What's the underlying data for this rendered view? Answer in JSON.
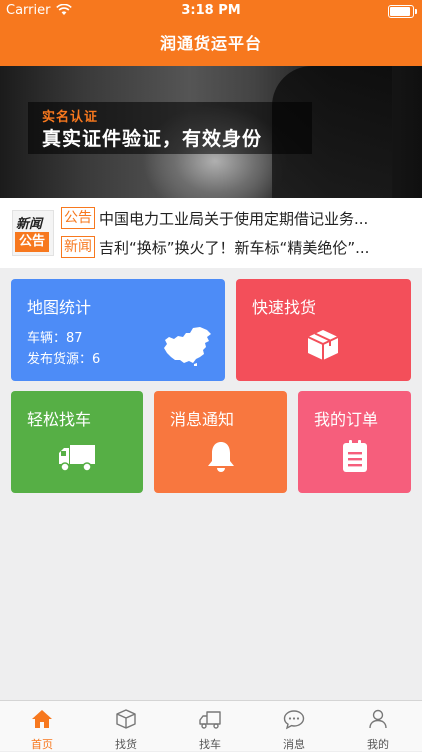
{
  "statusbar": {
    "carrier": "Carrier",
    "time": "3:18 PM"
  },
  "navbar": {
    "title": "润通货运平台"
  },
  "banner": {
    "small_text": "实名认证",
    "big_text": "真实证件验证，有效身份"
  },
  "news": {
    "logo_line1": "新闻",
    "logo_line2": "公告",
    "items": [
      {
        "tag": "公告",
        "text": "中国电力工业局关于使用定期借记业务..."
      },
      {
        "tag": "新闻",
        "text": "吉利“换标”换火了！新车标“精美绝伦”..."
      }
    ]
  },
  "tiles": {
    "map": {
      "title": "地图统计",
      "vehicles_label": "车辆：",
      "vehicles": "87",
      "goods_label": "发布货源：",
      "goods": "6",
      "color": "#4d8cf7"
    },
    "goods": {
      "title": "快速找货",
      "color": "#f34f5a"
    },
    "car": {
      "title": "轻松找车",
      "color": "#56af45"
    },
    "notice": {
      "title": "消息通知",
      "color": "#f8773f"
    },
    "order": {
      "title": "我的订单",
      "color": "#f65e7c"
    }
  },
  "tabbar": {
    "accent": "#f7781e",
    "items": [
      {
        "label": "首页",
        "icon": "home-icon",
        "active": true
      },
      {
        "label": "找货",
        "icon": "box-icon",
        "active": false
      },
      {
        "label": "找车",
        "icon": "truck-icon",
        "active": false
      },
      {
        "label": "消息",
        "icon": "message-icon",
        "active": false
      },
      {
        "label": "我的",
        "icon": "user-icon",
        "active": false
      }
    ]
  }
}
